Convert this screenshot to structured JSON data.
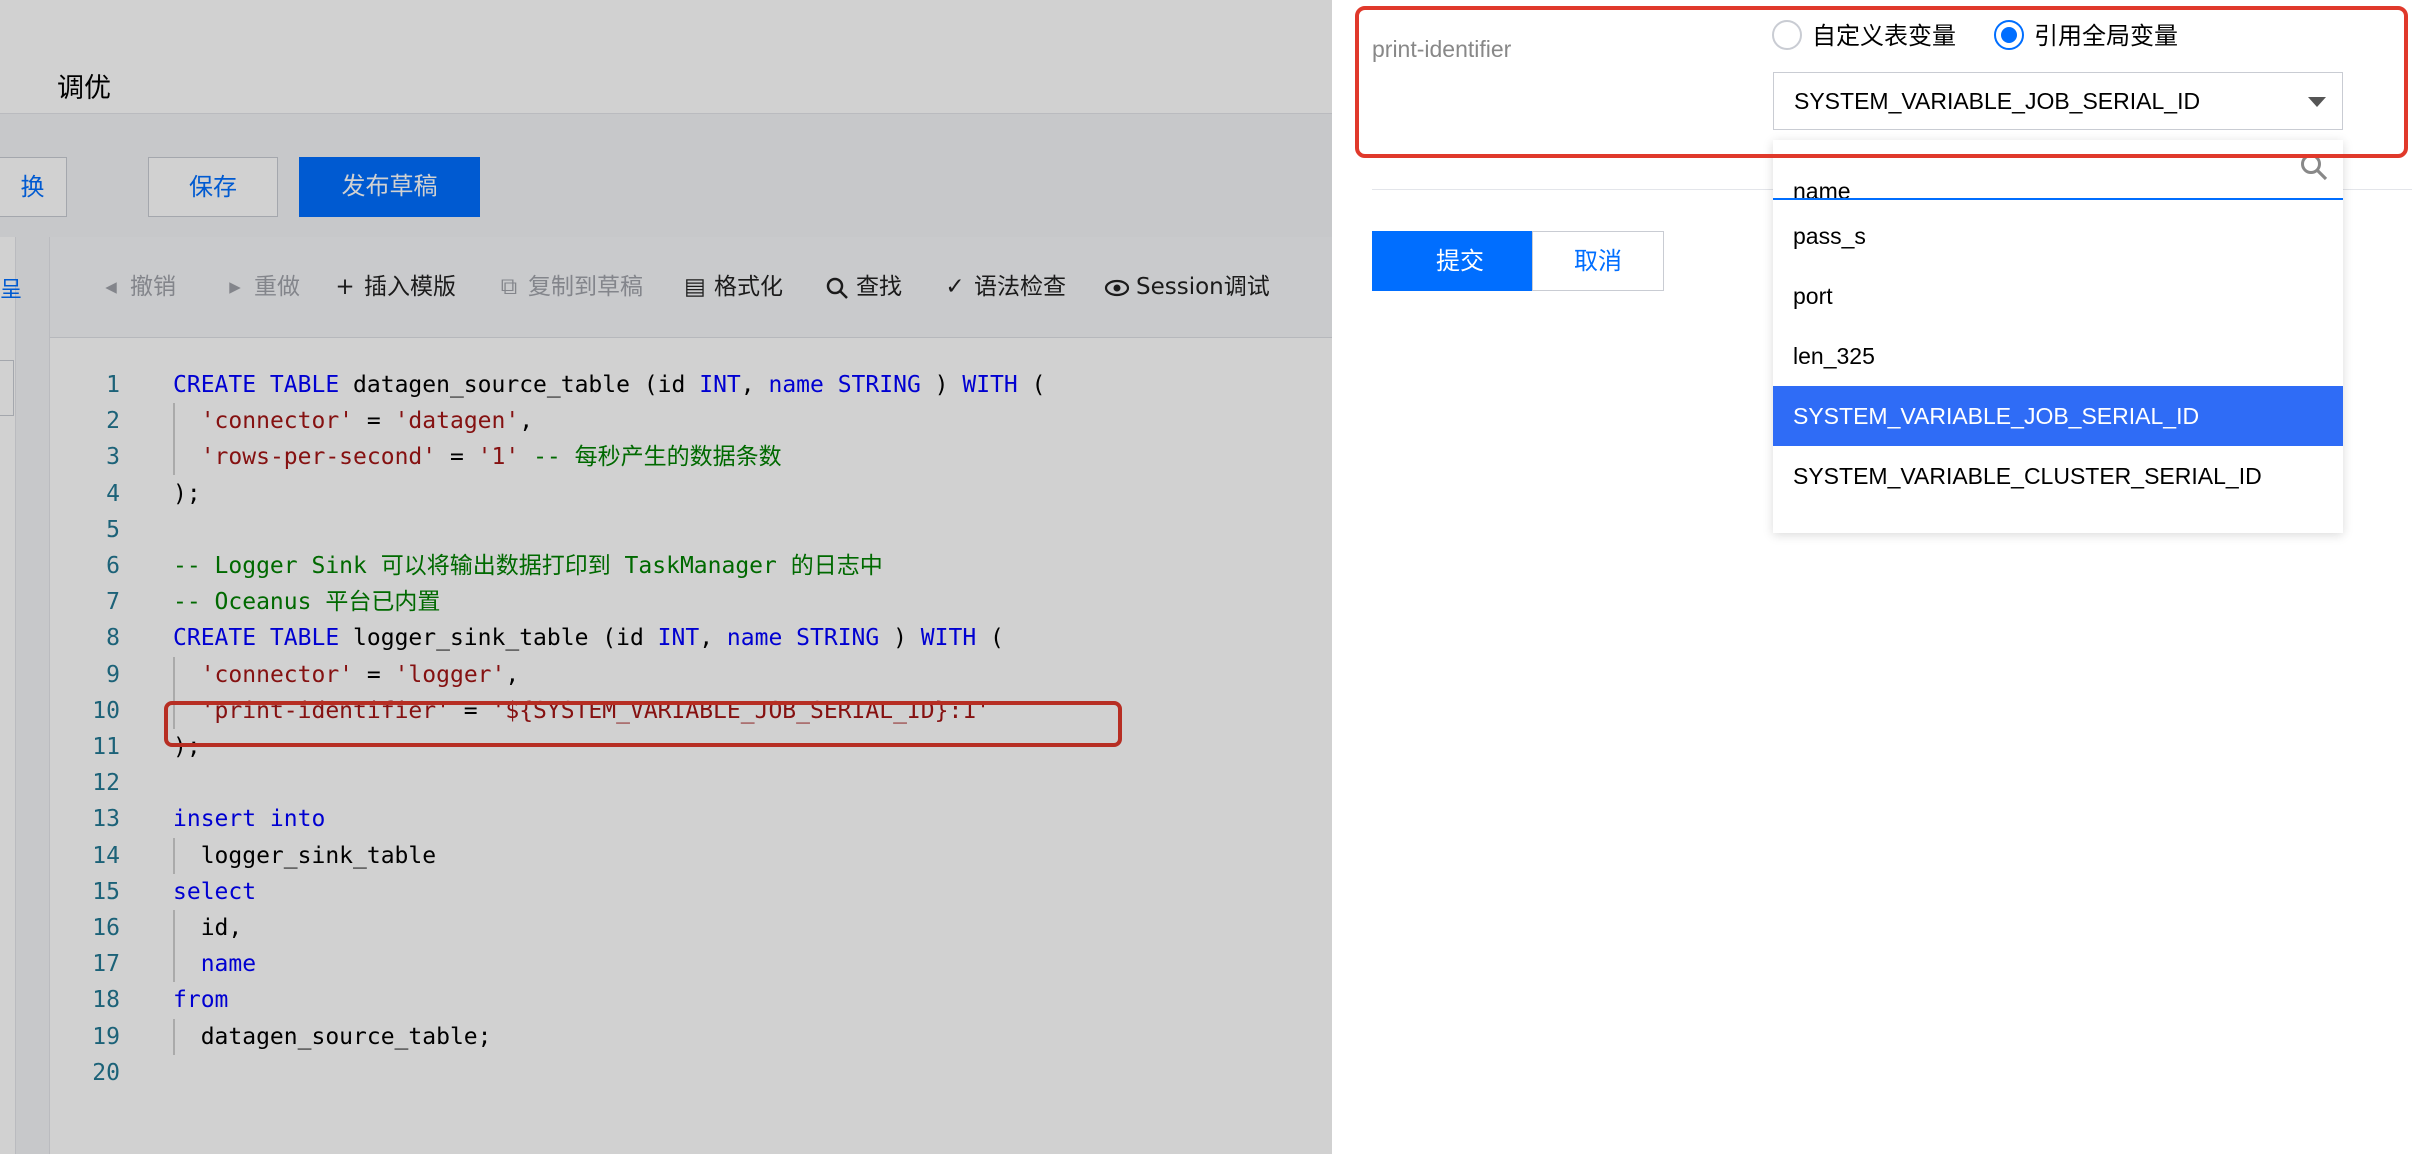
{
  "page": {
    "title": "调优",
    "buttons": {
      "switch_label": "换",
      "save_label": "保存",
      "publish_label": "发布草稿"
    },
    "side_glyph": "呈"
  },
  "toolbar": {
    "undo": "撤销",
    "redo": "重做",
    "insert_template": "插入模版",
    "copy_to_draft": "复制到草稿",
    "format": "格式化",
    "find": "查找",
    "syntax_check": "语法检查",
    "session_debug": "Session调试"
  },
  "editor": {
    "lines": [
      {
        "n": "1",
        "tokens": [
          [
            "kw",
            "CREATE TABLE"
          ],
          [
            "",
            "datagen_source_table (id "
          ],
          [
            "kw",
            "INT"
          ],
          [
            "",
            ", "
          ],
          [
            "kw",
            "name"
          ],
          [
            "",
            ""
          ],
          [
            "kw",
            " STRING"
          ],
          [
            "",
            " ) "
          ],
          [
            "kw",
            "WITH"
          ],
          [
            "",
            " ("
          ]
        ]
      },
      {
        "n": "2",
        "indent": true,
        "tokens": [
          [
            "",
            "  "
          ],
          [
            "str",
            "'connector'"
          ],
          [
            "",
            " = "
          ],
          [
            "str",
            "'datagen'"
          ],
          [
            "",
            ","
          ]
        ]
      },
      {
        "n": "3",
        "indent": true,
        "tokens": [
          [
            "",
            "  "
          ],
          [
            "str",
            "'rows-per-second'"
          ],
          [
            "",
            " = "
          ],
          [
            "str",
            "'1'"
          ],
          [
            "",
            " "
          ],
          [
            "cm",
            "-- 每秒产生的数据条数"
          ]
        ]
      },
      {
        "n": "4",
        "tokens": [
          [
            "",
            ");"
          ]
        ]
      },
      {
        "n": "5",
        "tokens": []
      },
      {
        "n": "6",
        "tokens": [
          [
            "cm",
            "-- Logger Sink 可以将输出数据打印到 TaskManager 的日志中"
          ]
        ]
      },
      {
        "n": "7",
        "tokens": [
          [
            "cm",
            "-- Oceanus 平台已内置"
          ]
        ]
      },
      {
        "n": "8",
        "tokens": [
          [
            "kw",
            "CREATE TABLE"
          ],
          [
            "",
            "logger_sink_table (id "
          ],
          [
            "kw",
            "INT"
          ],
          [
            "",
            ", "
          ],
          [
            "kw",
            "name"
          ],
          [
            "kw",
            " STRING"
          ],
          [
            "",
            " ) "
          ],
          [
            "kw",
            "WITH"
          ],
          [
            "",
            " ("
          ]
        ]
      },
      {
        "n": "9",
        "indent": true,
        "tokens": [
          [
            "",
            "  "
          ],
          [
            "str",
            "'connector'"
          ],
          [
            "",
            " = "
          ],
          [
            "str",
            "'logger'"
          ],
          [
            "",
            ","
          ]
        ]
      },
      {
        "n": "10",
        "indent": true,
        "tokens": [
          [
            "",
            "  "
          ],
          [
            "str",
            "'print-identifier'"
          ],
          [
            "",
            " = "
          ],
          [
            "str",
            "'${SYSTEM_VARIABLE_JOB_SERIAL_ID}:1'"
          ]
        ]
      },
      {
        "n": "11",
        "tokens": [
          [
            "",
            ");"
          ]
        ]
      },
      {
        "n": "12",
        "tokens": []
      },
      {
        "n": "13",
        "tokens": [
          [
            "kw",
            "insert into"
          ]
        ]
      },
      {
        "n": "14",
        "indent": true,
        "tokens": [
          [
            "",
            "  logger_sink_table"
          ]
        ]
      },
      {
        "n": "15",
        "tokens": [
          [
            "kw",
            "select"
          ]
        ]
      },
      {
        "n": "16",
        "indent": true,
        "tokens": [
          [
            "",
            "  id,"
          ]
        ]
      },
      {
        "n": "17",
        "indent": true,
        "tokens": [
          [
            "",
            "  "
          ],
          [
            "kw",
            "name"
          ]
        ]
      },
      {
        "n": "18",
        "tokens": [
          [
            "kw",
            "from"
          ]
        ]
      },
      {
        "n": "19",
        "indent": true,
        "tokens": [
          [
            "",
            "  datagen_source_table;"
          ]
        ]
      },
      {
        "n": "20",
        "tokens": []
      }
    ]
  },
  "drawer": {
    "param_label": "print-identifier",
    "radio_custom": "自定义表变量",
    "radio_global": "引用全局变量",
    "selected_value": "SYSTEM_VARIABLE_JOB_SERIAL_ID",
    "submit_label": "提交",
    "cancel_label": "取消"
  },
  "dropdown": {
    "search_placeholder": "",
    "partial_item": "name",
    "options": [
      {
        "label": "pass_s",
        "selected": false
      },
      {
        "label": "port",
        "selected": false
      },
      {
        "label": "len_325",
        "selected": false
      },
      {
        "label": "SYSTEM_VARIABLE_JOB_SERIAL_ID",
        "selected": true
      },
      {
        "label": "SYSTEM_VARIABLE_CLUSTER_SERIAL_ID",
        "selected": false
      }
    ]
  },
  "colors": {
    "accent": "#006eff",
    "highlight_border": "#e0392b",
    "selected_option_bg": "#2f6cf6"
  }
}
